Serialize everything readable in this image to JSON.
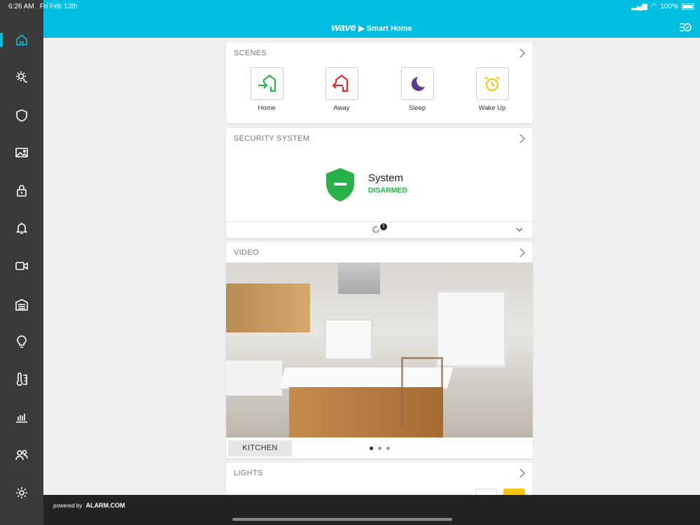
{
  "status_bar": {
    "time": "6:26 AM",
    "date": "Fri Feb 13th",
    "battery": "100%"
  },
  "header": {
    "logo": "wave",
    "title": "Smart Home"
  },
  "sidebar": {
    "items": [
      "home-icon",
      "sun-moon-icon",
      "shield-icon",
      "image-icon",
      "lock-icon",
      "bell-icon",
      "video-camera-icon",
      "garage-icon",
      "lightbulb-icon",
      "thermostat-icon",
      "chart-icon",
      "users-icon",
      "gear-icon"
    ],
    "accent": "#00bee0"
  },
  "scenes": {
    "title": "SCENES",
    "items": [
      {
        "label": "Home",
        "color": "#2bb14a"
      },
      {
        "label": "Away",
        "color": "#e02a2a"
      },
      {
        "label": "Sleep",
        "color": "#5c3a8e"
      },
      {
        "label": "Wake Up",
        "color": "#f5c400"
      }
    ]
  },
  "security": {
    "title": "SECURITY SYSTEM",
    "system_label": "System",
    "state": "DISARMED",
    "state_color": "#2bb14a",
    "badge_count": "1"
  },
  "video": {
    "title": "VIDEO",
    "camera_label": "KITCHEN",
    "page_count": 3,
    "active_page": 1
  },
  "lights": {
    "title": "LIGHTS"
  },
  "footer": {
    "powered_by": "powered by",
    "brand": "ALARM.COM"
  }
}
